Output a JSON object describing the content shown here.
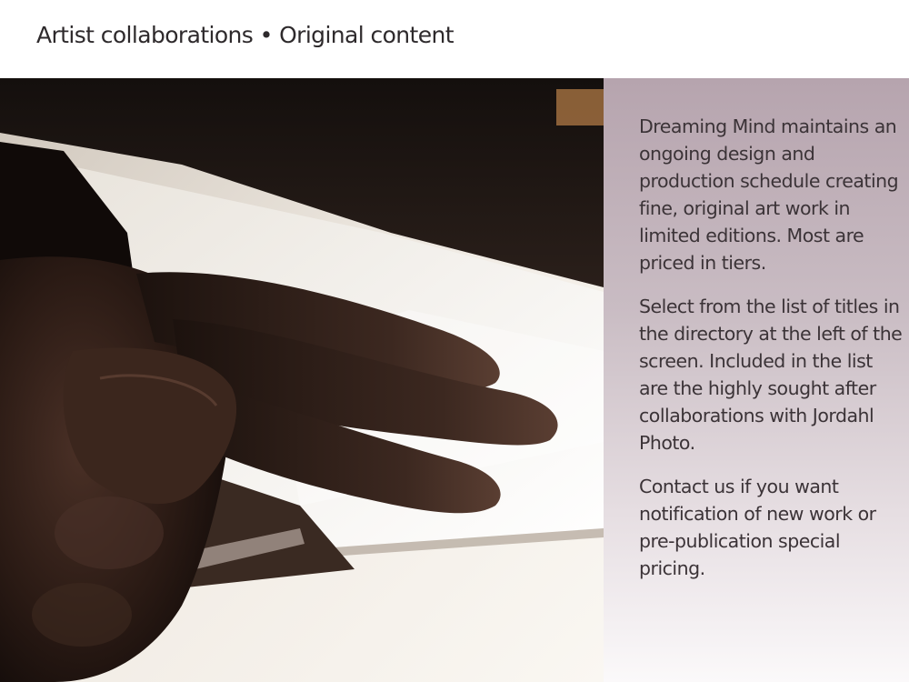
{
  "header": {
    "title": "Artist collaborations • Original content"
  },
  "photo": {
    "subject": "hand-trimming-print-icon"
  },
  "sidebar": {
    "paragraphs": [
      "Dreaming Mind maintains an ongoing design and production schedule creating fine, original art work in limited editions. Most are priced in tiers.",
      "Select from the list of titles in the directory at the left of the screen. Included in the list are the highly sought after collaborations with Jordahl Photo.",
      "Contact us if you want notification of new work or pre-publication special pricing."
    ]
  },
  "colors": {
    "sidebar_top": "#b6a4ae",
    "sidebar_bottom": "#fbf9fa",
    "text": "#3b3337"
  }
}
